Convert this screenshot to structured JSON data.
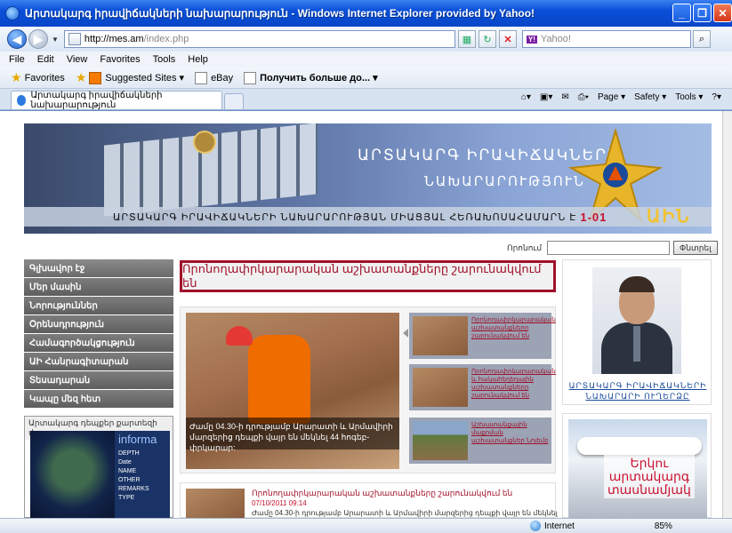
{
  "window": {
    "title": "Արտակարգ իրավիճակների նախարարություն - Windows Internet Explorer provided by Yahoo!",
    "minimize": "_",
    "maximize": "❐",
    "close": "✕"
  },
  "address": {
    "url_host": "http://mes.am",
    "url_path": "/index.php",
    "search_placeholder": "Yahoo!"
  },
  "menu": [
    "File",
    "Edit",
    "View",
    "Favorites",
    "Tools",
    "Help"
  ],
  "favorites": {
    "label": "Favorites",
    "items": [
      "Suggested Sites ▾",
      "eBay",
      "Получить больше до... ▾"
    ]
  },
  "tab": {
    "label": "Արտակարգ իրավիճակների նախարարություն"
  },
  "commands": [
    "Page ▾",
    "Safety ▾",
    "Tools ▾"
  ],
  "banner": {
    "line1": "ԱՐՏԱԿԱՐԳ ԻՐԱՎԻՃԱԿՆԵՐԻ",
    "line2": "ՆԱԽԱՐԱՐՈՒԹՅՈՒՆ",
    "hotline": "ԱՐՏԱԿԱՐԳ ԻՐԱՎԻՃԱԿՆԵՐԻ ՆԱԽԱՐԱՐՈՒԹՅԱՆ ՄԻԱՑՅԱԼ ՀԵՌԱԽՈՍԱՀԱՄԱՐՆ Է",
    "hotline_number": "1-01",
    "logo_text": "ԱԻՆ"
  },
  "site_search": {
    "label": "Որոնում",
    "button": "Փնտրել"
  },
  "left_nav": [
    "Գլխավոր էջ",
    "Մեր մասին",
    "Նորություններ",
    "Օրենսդրություն",
    "Համագործակցություն",
    "ԱԻ Հանրագիտարան",
    "Տեսադարան",
    "Կապը մեզ հետ"
  ],
  "map": {
    "title": "Արտակարգ դեպքեր քարտեզի վրա",
    "heading": "informa",
    "fields": [
      "DEPTH",
      "Date",
      "NAME",
      "OTHER",
      "REMARKS",
      "TYPE"
    ]
  },
  "alert": {
    "text": "Որոնողափրկարարական աշխատանքները շարունակվում են"
  },
  "slider": {
    "caption": "Ժամը 04.30-ի դրությամբ Արարատի և Արմավիրի մարզերից դեպքի վայր են մեկնել 44 հոգեբ-փրկարար:",
    "thumbs": [
      "Որոնողափրկարարական աշխատանքները շարունակվում են",
      "Որոնողափրկարարական և հակահեղեղային աշխատանքները շարունակվում են",
      "Աշխատանքային մաքրման աշխատանքներ Նոյեմբ"
    ]
  },
  "news": {
    "title": "Որոնողափրկարարական աշխատանքները շարունակվում են",
    "date": "07/10/2011 09:14",
    "text": "Ժամը 04.30-ի դրությամբ Արարատի և Արմավիրի մարզերից դեպքի վայր են մեկնել"
  },
  "minister": {
    "caption_line1": "ԱՐՏԱԿԱՐԳ ԻՐԱՎԻՃԱԿՆԵՐԻ",
    "caption_line2": "ՆԱԽԱՐԱՐԻ ՈՒՂԵՐՁԸ"
  },
  "promo": {
    "line1": "Երկու",
    "line2": "արտակարգ",
    "line3": "տասնամյակ"
  },
  "status": {
    "zone": "Internet",
    "zoom": "85%"
  },
  "colors": {
    "accent_red": "#a0112a",
    "nav_gray": "#6a6a6a",
    "titlebar_blue": "#0a4fd8"
  }
}
